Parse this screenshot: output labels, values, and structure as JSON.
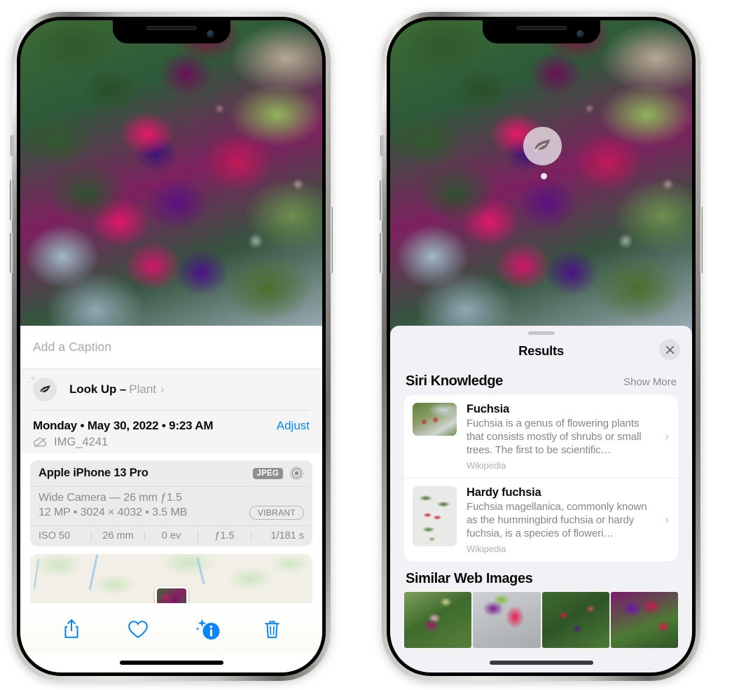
{
  "left_phone": {
    "caption": {
      "placeholder": "Add a Caption",
      "value": ""
    },
    "lookup": {
      "icon": "leaf-icon",
      "sparkle_icon": "sparkle-icon",
      "title": "Look Up –",
      "subject": "Plant",
      "chevron": "›"
    },
    "meta": {
      "date": "Monday • May 30, 2022 • 9:23 AM",
      "adjust_label": "Adjust",
      "cloud_icon": "icloud-slash-icon",
      "filename": "IMG_4241"
    },
    "camera_card": {
      "model": "Apple iPhone 13 Pro",
      "format_badge": "JPEG",
      "aperture_icon": "aperture-icon",
      "lens_line": "Wide Camera — 26 mm ƒ1.5",
      "spec_line": "12 MP • 3024 × 4032 • 3.5 MB",
      "profile_badge": "VIBRANT",
      "exif": [
        "ISO 50",
        "26 mm",
        "0 ev",
        "ƒ1.5",
        "1/181 s"
      ]
    },
    "map": {
      "pin_icon": "photo-pin"
    },
    "toolbar": [
      {
        "name": "share-button",
        "icon": "share-icon"
      },
      {
        "name": "favorite-button",
        "icon": "heart-icon"
      },
      {
        "name": "info-button",
        "icon": "info-sparkle-icon"
      },
      {
        "name": "delete-button",
        "icon": "trash-icon"
      }
    ]
  },
  "right_phone": {
    "visual_lookup_badge": {
      "icon": "leaf-icon"
    },
    "sheet": {
      "title": "Results",
      "close_icon": "close-icon",
      "grabber": "grabber-handle"
    },
    "siri_knowledge": {
      "title": "Siri Knowledge",
      "show_more": "Show More",
      "items": [
        {
          "name": "Fuchsia",
          "description": "Fuchsia is a genus of flowering plants that consists mostly of shrubs or small trees. The first to be scientific…",
          "source": "Wikipedia",
          "chevron": "›"
        },
        {
          "name": "Hardy fuchsia",
          "description": "Fuchsia magellanica, commonly known as the hummingbird fuchsia or hardy fuchsia, is a species of floweri…",
          "source": "Wikipedia",
          "chevron": "›"
        }
      ]
    },
    "similar_web_images": {
      "title": "Similar Web Images",
      "count": 4
    }
  },
  "colors": {
    "accent_blue": "#0a84ff",
    "sheet_background": "#f2f1f6",
    "card_background": "#ffffff",
    "info_panel_background": "#f5f5f7",
    "camera_card_background": "#ebebee",
    "secondary_text": "#8a8a8f",
    "badge_gray": "#8e8e93"
  }
}
